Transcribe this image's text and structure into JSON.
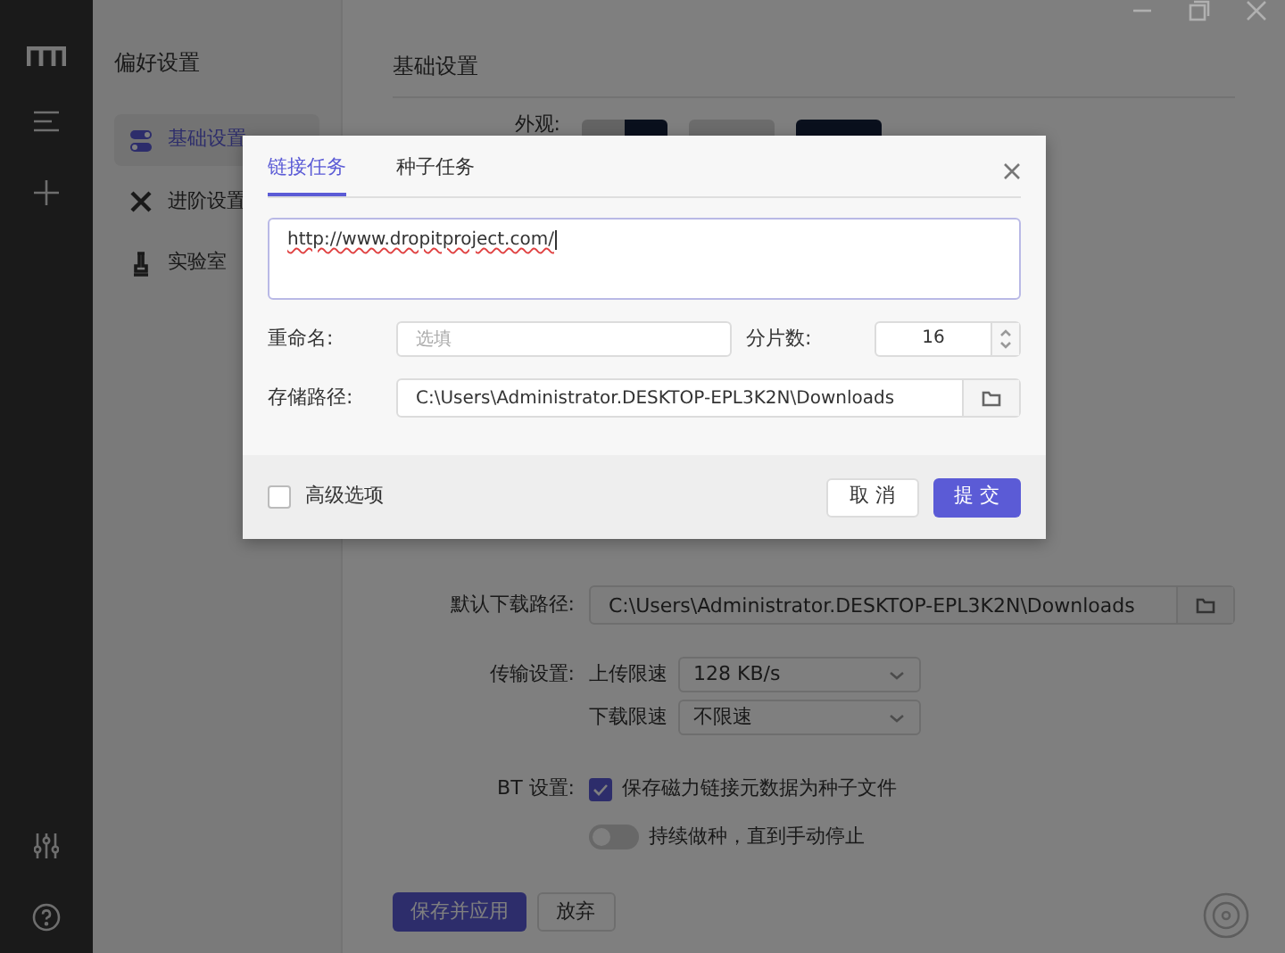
{
  "preferences": {
    "title": "偏好设置",
    "items": [
      {
        "label": "基础设置",
        "selected": true
      },
      {
        "label": "进阶设置",
        "selected": false
      },
      {
        "label": "实验室",
        "selected": false
      }
    ]
  },
  "settings": {
    "title": "基础设置",
    "appearance_label": "外观:",
    "default_path": {
      "label": "默认下载路径:",
      "value": "C:\\Users\\Administrator.DESKTOP-EPL3K2N\\Downloads"
    },
    "transfer": {
      "label": "传输设置:",
      "limits": [
        {
          "label": "上传限速",
          "value": "128 KB/s"
        },
        {
          "label": "下载限速",
          "value": "不限速"
        }
      ]
    },
    "bt": {
      "label": "BT 设置:",
      "save_magnet": {
        "label": "保存磁力链接元数据为种子文件",
        "checked": true
      },
      "keep_seeding": {
        "label": "持续做种，直到手动停止",
        "on": false
      }
    },
    "buttons": [
      {
        "label": "保存并应用",
        "kind": "primary"
      },
      {
        "label": "放弃",
        "kind": "secondary"
      }
    ]
  },
  "dialog": {
    "tabs": [
      {
        "label": "链接任务",
        "selected": true
      },
      {
        "label": "种子任务",
        "selected": false
      }
    ],
    "url": "http://www.dropitproject.com/",
    "rename": {
      "label": "重命名:",
      "placeholder": "选填"
    },
    "splits": {
      "label": "分片数:",
      "value": "16"
    },
    "path": {
      "label": "存储路径:",
      "value": "C:\\Users\\Administrator.DESKTOP-EPL3K2N\\Downloads"
    },
    "advanced": {
      "label": "高级选项",
      "checked": false
    },
    "buttons": [
      {
        "label": "取 消",
        "kind": "secondary"
      },
      {
        "label": "提 交",
        "kind": "primary"
      }
    ]
  }
}
